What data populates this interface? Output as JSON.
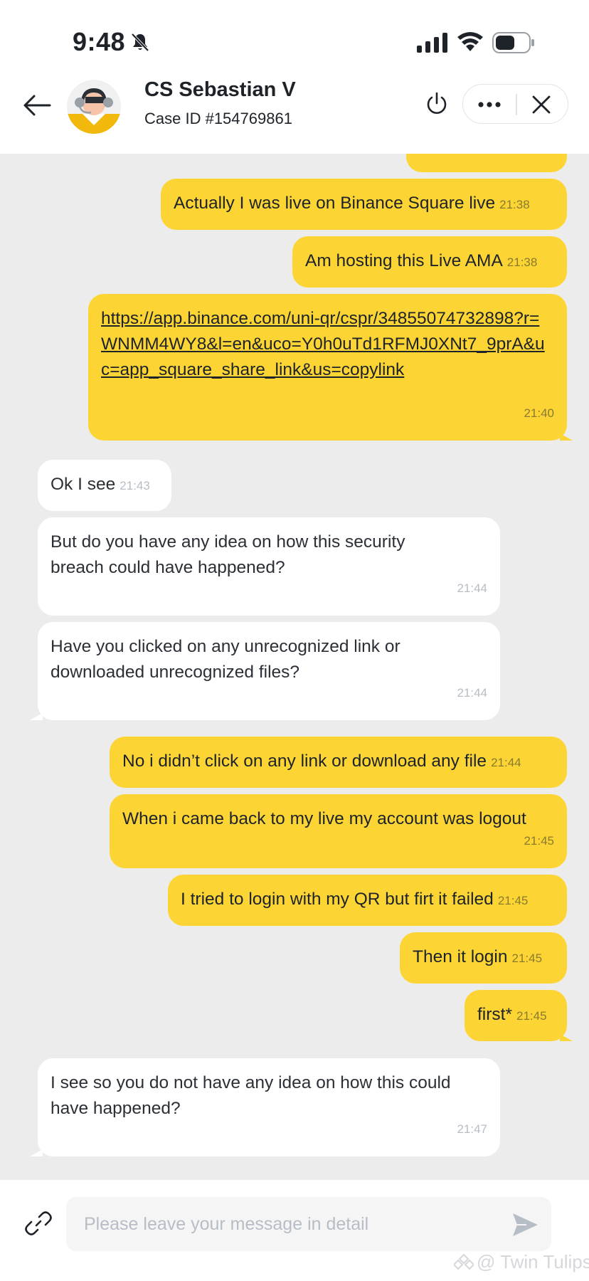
{
  "status_bar": {
    "time": "9:48",
    "icons": [
      "bell-muted-icon",
      "signal-icon",
      "wifi-icon",
      "battery-icon"
    ]
  },
  "header": {
    "agent_name": "CS Sebastian V",
    "case_id": "Case ID #154769861",
    "icons": [
      "back-arrow-icon",
      "agent-avatar",
      "power-icon",
      "more-icon",
      "close-icon"
    ]
  },
  "messages": [
    {
      "dir": "out",
      "text": "Actually I was live on Binance Square live",
      "time": "21:38"
    },
    {
      "dir": "out",
      "text": "Am hosting this Live AMA",
      "time": "21:38"
    },
    {
      "dir": "out",
      "type": "link",
      "text": "https://app.binance.com/uni-qr/cspr/34855074732898?r=WNMM4WY8&l=en&uco=Y0h0uTd1RFMJ0XNt7_9prA&uc=app_square_share_link&us=copylink",
      "time": "21:40"
    },
    {
      "dir": "in",
      "text": "Ok I see",
      "time": "21:43"
    },
    {
      "dir": "in",
      "text": "But do you have any idea on how this security breach could have happened?",
      "time": "21:44"
    },
    {
      "dir": "in",
      "text": "Have you clicked on any unrecognized link or downloaded unrecognized files?",
      "time": "21:44"
    },
    {
      "dir": "out",
      "text": "No i didn’t click on any link or download any file",
      "time": "21:44"
    },
    {
      "dir": "out",
      "text": "When i came back to my live my account was logout",
      "time": "21:45"
    },
    {
      "dir": "out",
      "text": "I tried to login with my QR but firt it failed",
      "time": "21:45"
    },
    {
      "dir": "out",
      "text": "Then it login",
      "time": "21:45"
    },
    {
      "dir": "out",
      "text": "first*",
      "time": "21:45"
    },
    {
      "dir": "in",
      "text": "I see so you do not have any idea on how this could have happened?",
      "time": "21:47"
    }
  ],
  "input": {
    "placeholder": "Please leave your message in detail",
    "icons": [
      "attach-link-icon",
      "send-icon"
    ]
  },
  "watermark": "@ Twin Tulips",
  "colors": {
    "outgoing_bubble": "#fcd535",
    "incoming_bubble": "#ffffff",
    "chat_background": "#ececec",
    "text": "#1e2329"
  }
}
